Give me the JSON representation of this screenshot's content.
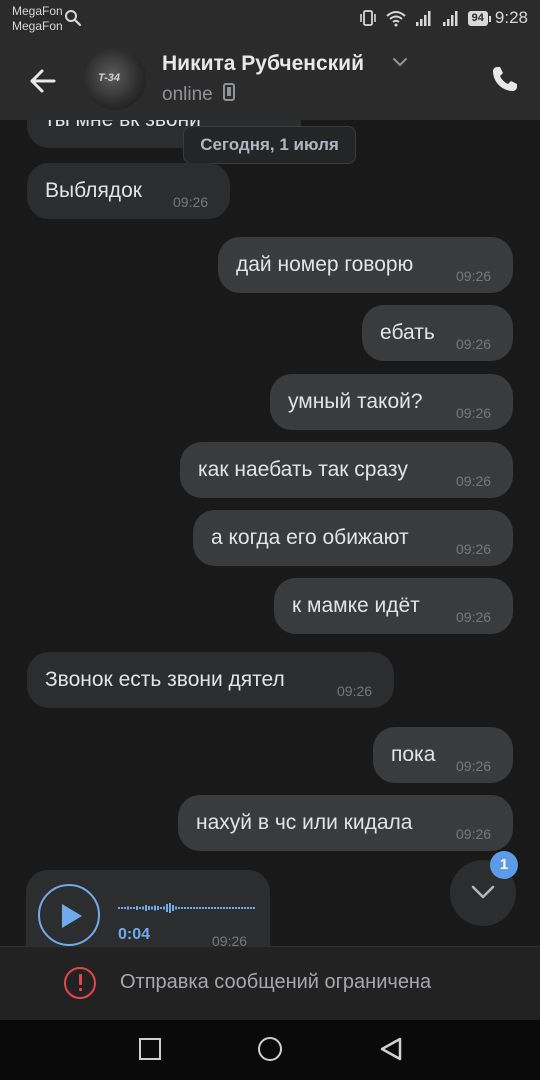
{
  "status_bar": {
    "carrier_1": "MegaFon",
    "carrier_2": "MegaFon",
    "battery": "94",
    "time": "9:28"
  },
  "header": {
    "contact_name": "Никита Рубченский",
    "status": "online",
    "avatar_text": "T-34"
  },
  "chat": {
    "date_label": "Сегодня, 1 июля",
    "partial_message": "ты мне вк звони",
    "messages": [
      {
        "dir": "in",
        "text": "Выблядок",
        "time": "09:26"
      },
      {
        "dir": "out",
        "text": "дай номер говорю",
        "time": "09:26"
      },
      {
        "dir": "out",
        "text": "ебать",
        "time": "09:26"
      },
      {
        "dir": "out",
        "text": "умный такой?",
        "time": "09:26"
      },
      {
        "dir": "out",
        "text": "как наебать так сразу",
        "time": "09:26"
      },
      {
        "dir": "out",
        "text": "а когда его обижают",
        "time": "09:26"
      },
      {
        "dir": "out",
        "text": "к мамке идёт",
        "time": "09:26"
      },
      {
        "dir": "in",
        "text": "Звонок есть звони дятел",
        "time": "09:26"
      },
      {
        "dir": "out",
        "text": "пока",
        "time": "09:26"
      },
      {
        "dir": "out",
        "text": "нахуй в чс или кидала",
        "time": "09:26"
      }
    ],
    "voice_message": {
      "duration": "0:04",
      "time": "09:26"
    },
    "unread_count": "1"
  },
  "composer": {
    "restricted_text": "Отправка сообщений ограничена"
  },
  "colors": {
    "background": "#19191a",
    "header": "#2b2b2c",
    "bubble_in": "#2c2d2e",
    "bubble_out": "#3a3b3c",
    "accent": "#71aaeb",
    "warning": "#e64646",
    "badge": "#5c9ce6"
  },
  "icons": {
    "back": "arrow-left-icon",
    "phone": "phone-icon",
    "device": "mobile-device-icon",
    "chevron": "chevron-down-icon",
    "play": "play-icon",
    "scroll": "chevron-down-icon",
    "warning": "exclamation-circle-icon"
  }
}
